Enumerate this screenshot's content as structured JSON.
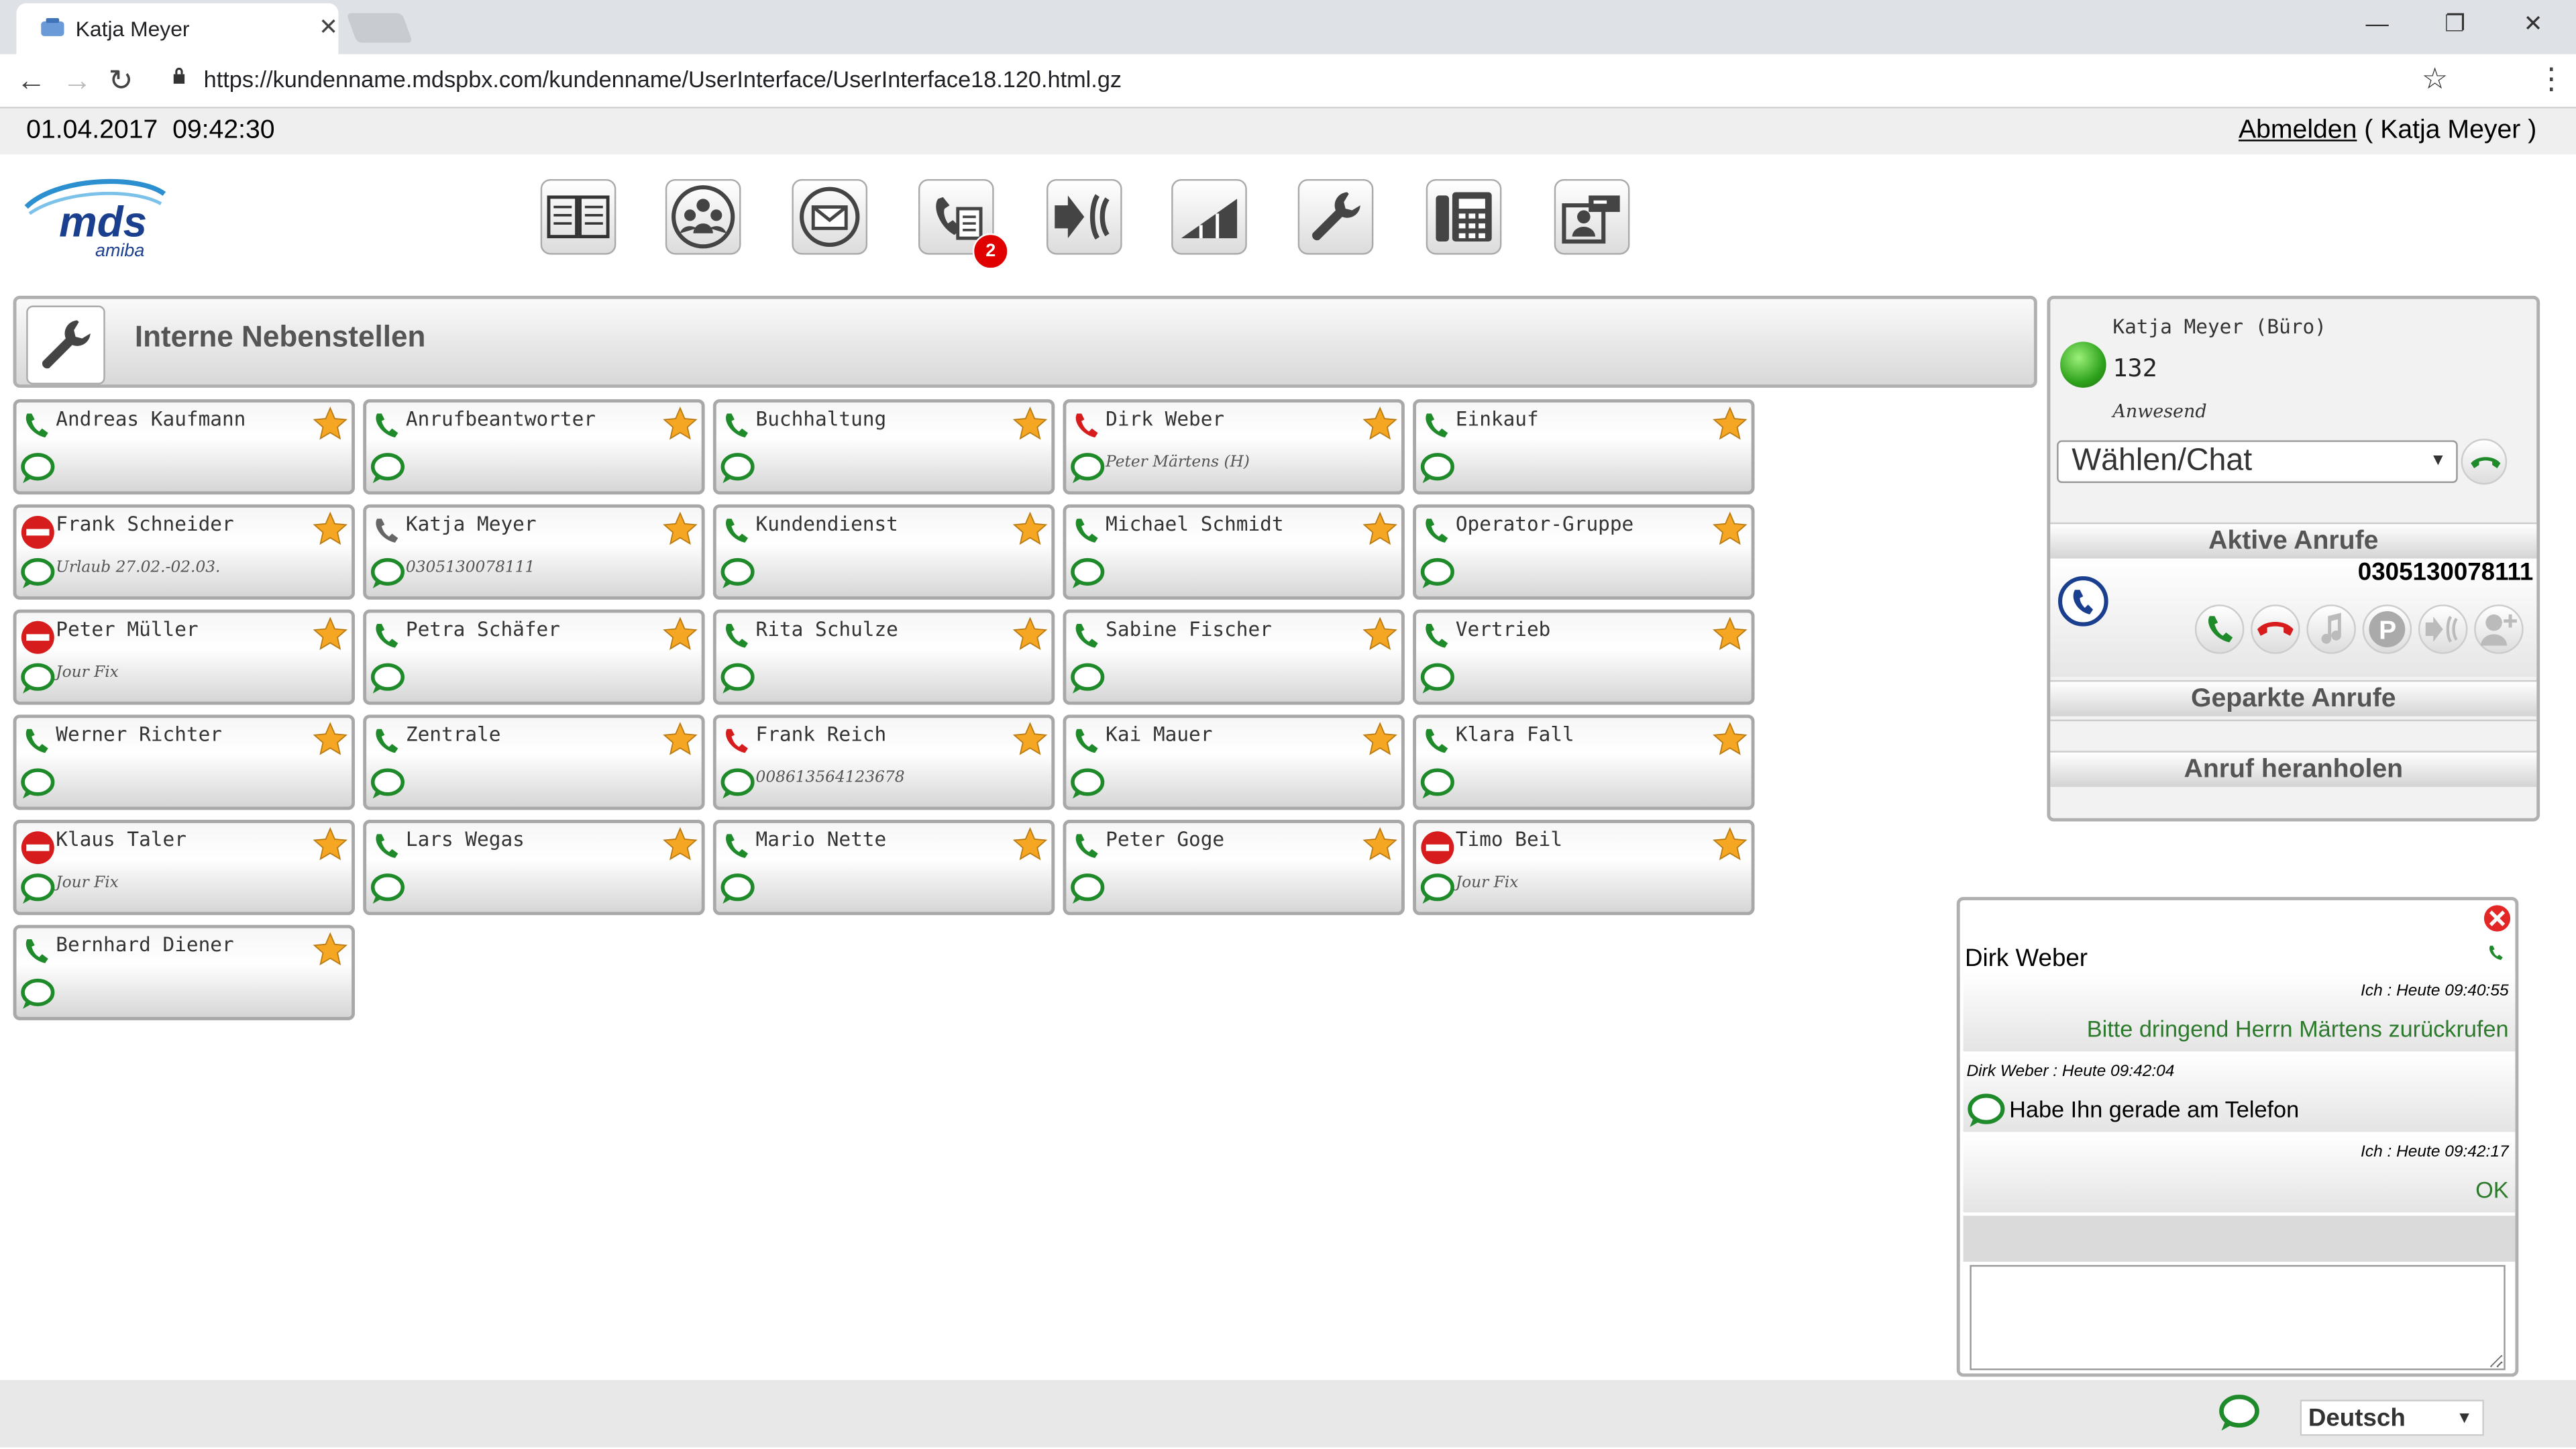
{
  "browser": {
    "tab_title": "Katja Meyer",
    "url": "https://kundenname.mdspbx.com/kundenname/UserInterface/UserInterface18.120.html.gz"
  },
  "header": {
    "date": "01.04.2017",
    "time": "09:42:30",
    "logout_label": "Abmelden",
    "logout_user": "( Katja Meyer )"
  },
  "logo": {
    "main": "mds",
    "sub": "amiba"
  },
  "toolbar": {
    "badge_count": "2",
    "icons": [
      "phonebook-icon",
      "groups-icon",
      "mail-icon",
      "calllist-icon",
      "forward-icon",
      "signal-icon",
      "settings-wrench-icon",
      "phone-device-icon",
      "contact-card-icon"
    ]
  },
  "section": {
    "title": "Interne Nebenstellen"
  },
  "colors": {
    "green": "#1f8a2a",
    "red": "#d61c1c",
    "star": "#f5a623"
  },
  "contacts": [
    {
      "name": "Andreas Kaufmann",
      "sub": "",
      "status": "idle"
    },
    {
      "name": "Anrufbeantworter",
      "sub": "",
      "status": "idle"
    },
    {
      "name": "Buchhaltung",
      "sub": "",
      "status": "idle"
    },
    {
      "name": "Dirk Weber",
      "sub": "Peter Märtens (H)",
      "status": "busy"
    },
    {
      "name": "Einkauf",
      "sub": "",
      "status": "idle"
    },
    {
      "name": "Frank Schneider",
      "sub": "Urlaub 27.02.-02.03.",
      "status": "dnd"
    },
    {
      "name": "Katja Meyer",
      "sub": "0305130078111",
      "status": "self"
    },
    {
      "name": "Kundendienst",
      "sub": "",
      "status": "idle"
    },
    {
      "name": "Michael Schmidt",
      "sub": "",
      "status": "idle"
    },
    {
      "name": "Operator-Gruppe",
      "sub": "",
      "status": "idle"
    },
    {
      "name": "Peter Müller",
      "sub": "Jour Fix",
      "status": "dnd"
    },
    {
      "name": "Petra Schäfer",
      "sub": "",
      "status": "idle"
    },
    {
      "name": "Rita Schulze",
      "sub": "",
      "status": "idle"
    },
    {
      "name": "Sabine Fischer",
      "sub": "",
      "status": "idle"
    },
    {
      "name": "Vertrieb",
      "sub": "",
      "status": "idle"
    },
    {
      "name": "Werner Richter",
      "sub": "",
      "status": "idle"
    },
    {
      "name": "Zentrale",
      "sub": "",
      "status": "idle"
    },
    {
      "name": "Frank Reich",
      "sub": "008613564123678",
      "status": "busy"
    },
    {
      "name": "Kai Mauer",
      "sub": "",
      "status": "idle"
    },
    {
      "name": "Klara Fall",
      "sub": "",
      "status": "idle"
    },
    {
      "name": "Klaus Taler",
      "sub": "Jour Fix",
      "status": "dnd"
    },
    {
      "name": "Lars Wegas",
      "sub": "",
      "status": "idle"
    },
    {
      "name": "Mario Nette",
      "sub": "",
      "status": "idle"
    },
    {
      "name": "Peter Goge",
      "sub": "",
      "status": "idle"
    },
    {
      "name": "Timo Beil",
      "sub": "Jour Fix",
      "status": "dnd"
    },
    {
      "name": "Bernhard Diener",
      "sub": "",
      "status": "idle"
    }
  ],
  "user_panel": {
    "name": "Katja Meyer (Büro)",
    "extension": "132",
    "status": "Anwesend",
    "dial_label": "Wählen/Chat",
    "active_calls_label": "Aktive Anrufe",
    "active_call_number": "0305130078111",
    "parked_label": "Geparkte Anrufe",
    "pickup_label": "Anruf heranholen"
  },
  "chat": {
    "title": "Dirk Weber",
    "messages": [
      {
        "meta": "Ich : Heute 09:40:55",
        "text": "Bitte dringend Herrn Märtens zurückrufen",
        "own": true
      },
      {
        "meta": "Dirk Weber : Heute 09:42:04",
        "text": "Habe Ihn gerade am Telefon",
        "own": false
      },
      {
        "meta": "Ich : Heute 09:42:17",
        "text": "OK",
        "own": true
      }
    ]
  },
  "footer": {
    "language": "Deutsch"
  }
}
